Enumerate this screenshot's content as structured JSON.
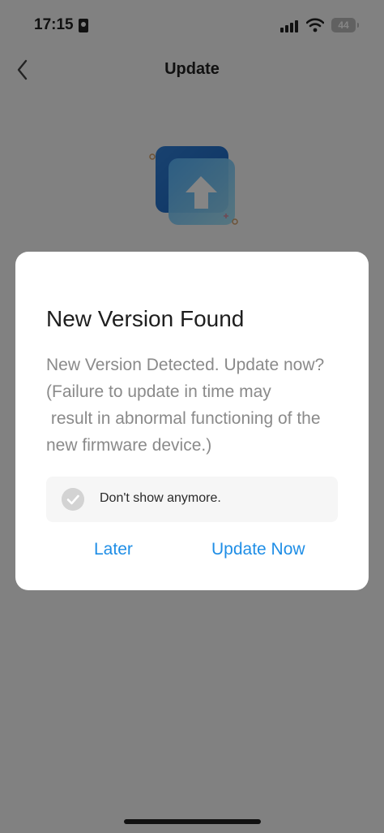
{
  "status_bar": {
    "time": "17:15",
    "battery": "44"
  },
  "nav": {
    "title": "Update"
  },
  "dialog": {
    "title": "New Version Found",
    "message": "New Version Detected. Update now? (Failure to update in time may\n result in abnormal functioning of the new firmware device.)",
    "checkbox_label": "Don't show anymore.",
    "later_label": "Later",
    "update_label": "Update Now"
  },
  "colors": {
    "accent": "#1f8ee6",
    "overlay": "rgba(0,0,0,0.48)"
  }
}
